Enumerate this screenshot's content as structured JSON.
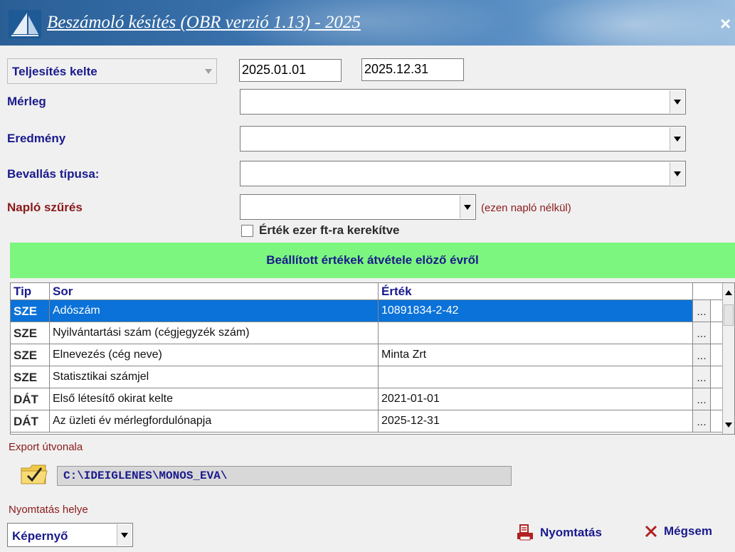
{
  "window": {
    "title": "Beszámoló késítés (OBR verzió 1.13) - 2025",
    "close_symbol": "×"
  },
  "period": {
    "type_value": "Teljesítés kelte",
    "date_from": "2025.01.01",
    "date_to": "2025.12.31"
  },
  "fields": {
    "merleg_label": "Mérleg",
    "merleg_value": "",
    "eredmeny_label": "Eredmény",
    "eredmeny_value": "",
    "bevallas_label": "Bevallás típusa:",
    "bevallas_value": "",
    "naplo_label": "Napló szűrés",
    "naplo_value": "",
    "naplo_note": "(ezen napló nélkül)",
    "rounding_label": "Érték ezer ft-ra kerekítve",
    "rounding_checked": false
  },
  "banner": {
    "text": "Beállított értékek átvétele elöző évről",
    "color": "#7cf67e"
  },
  "grid": {
    "headers": {
      "tip": "Tip",
      "sor": "Sor",
      "ertek": "Érték"
    },
    "rows": [
      {
        "tip": "SZE",
        "sor": "Adószám",
        "ertek": "10891834-2-42",
        "btn": "...",
        "selected": true
      },
      {
        "tip": "SZE",
        "sor": "Nyilvántartási szám (cégjegyzék szám)",
        "ertek": "",
        "btn": "...",
        "selected": false
      },
      {
        "tip": "SZE",
        "sor": "Elnevezés (cég neve)",
        "ertek": "Minta Zrt",
        "btn": "...",
        "selected": false
      },
      {
        "tip": "SZE",
        "sor": "Statisztikai számjel",
        "ertek": "",
        "btn": "...",
        "selected": false
      },
      {
        "tip": "DÁT",
        "sor": "Első létesítő okirat kelte",
        "ertek": "2021-01-01",
        "btn": "...",
        "selected": false
      },
      {
        "tip": "DÁT",
        "sor": "Az üzleti év mérlegfordulónapja",
        "ertek": "2025-12-31",
        "btn": "...",
        "selected": false
      }
    ]
  },
  "export": {
    "label": "Export útvonala",
    "path": "C:\\IDEIGLENES\\MONOS_EVA\\"
  },
  "print": {
    "label": "Nyomtatás helye",
    "target_value": "Képernyő",
    "print_button": "Nyomtatás",
    "cancel_button": "Mégsem"
  },
  "colors": {
    "selection": "#0a72d8",
    "label_blue": "#1a1a8c",
    "label_red": "#8b1a1a",
    "print_icon": "#b02020",
    "cancel_icon": "#b02020"
  },
  "icons": {
    "app": "sail-logo-icon",
    "folder": "folder-check-icon",
    "print": "printer-icon",
    "cancel": "x-icon"
  }
}
